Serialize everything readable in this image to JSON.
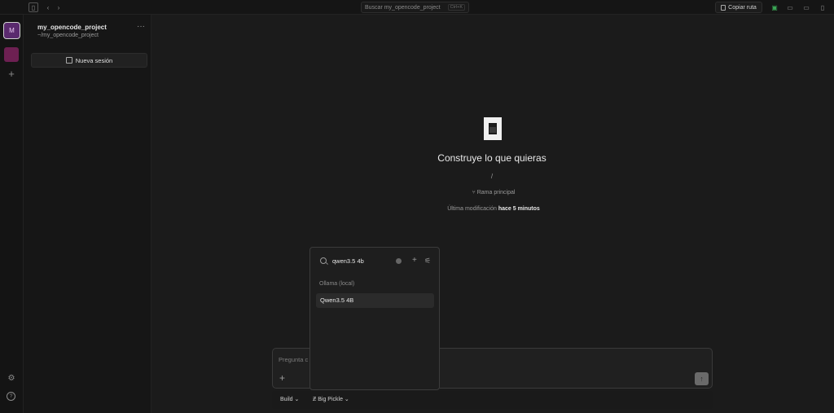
{
  "topbar": {
    "search_placeholder": "Buscar my_opencode_project",
    "search_shortcut": "Ctrl+K",
    "copy_path_label": "Copiar ruta"
  },
  "rail": {
    "active_project_initial": "M"
  },
  "sidebar": {
    "project_name": "my_opencode_project",
    "project_path": "~/my_opencode_project",
    "new_session_label": "Nueva sesión"
  },
  "main": {
    "headline": "Construye lo que quieras",
    "path_marker": "/",
    "branch_label": "Rama principal",
    "modified_prefix": "Última modificación",
    "modified_value": "hace 5 minutos"
  },
  "composer": {
    "placeholder": "Pregunta c",
    "mode_label": "Build",
    "model_label": "Big Pickle"
  },
  "model_picker": {
    "query": "qwen3.5 4b",
    "group_label": "Ollama (local)",
    "items": [
      {
        "label": "Qwen3.5 4B"
      }
    ]
  },
  "colors": {
    "background": "#1b1b1b",
    "accent_project": "#5a2a6e",
    "secondary_project": "#6d2052"
  }
}
